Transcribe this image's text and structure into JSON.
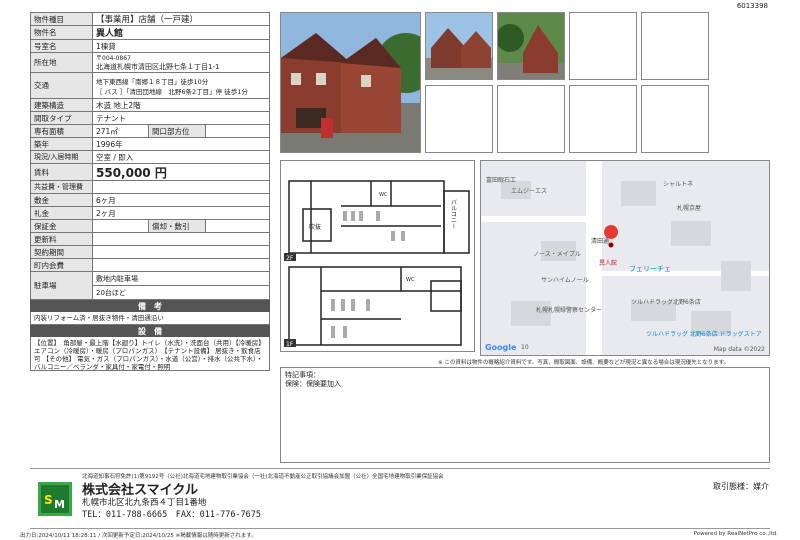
{
  "doc_id": "6013398",
  "table": {
    "rows": [
      {
        "label": "物件種目",
        "value": "【事業用】店舗（一戸建）"
      },
      {
        "label": "物件名",
        "value": "異人館"
      },
      {
        "label": "号室名",
        "value": "1棟貸"
      },
      {
        "label": "所在地",
        "value_line1": "〒004-0867",
        "value_line2": "北海道札幌市清田区北野七条１丁目1-1"
      },
      {
        "label": "交通",
        "value_line1": "地下東西線「南郷１８丁目」徒歩10分",
        "value_line2": "［ バス ］「清田団地線　北野6条2丁目」停 徒歩1分"
      },
      {
        "label": "建築構造",
        "value": "木造 地上2階"
      },
      {
        "label": "間取タイプ",
        "value": "テナント"
      },
      {
        "label": "専有面積",
        "value": "271㎡",
        "sub_label": "間口部方位",
        "sub_value": ""
      },
      {
        "label": "築年",
        "value": "1996年"
      },
      {
        "label": "現況/入居時期",
        "value": "空室 / 即入"
      },
      {
        "label": "賃料",
        "value": "550,000 円"
      },
      {
        "label": "共益費・管理費",
        "value": ""
      },
      {
        "label": "敷金",
        "value": "6ヶ月"
      },
      {
        "label": "礼金",
        "value": "2ヶ月"
      },
      {
        "label": "保証金",
        "value": "",
        "sub_label": "償却・敷引",
        "sub_value": ""
      },
      {
        "label": "更新料",
        "value": ""
      },
      {
        "label": "契約期間",
        "value": ""
      },
      {
        "label": "町内会費",
        "value": ""
      },
      {
        "label": "駐車場",
        "value": "敷地内駐車場",
        "value2": "20台ほど"
      }
    ],
    "remarks_header": "備　考",
    "remarks_text": "内装リフォーム済・居抜き物件・清田通沿い",
    "facilities_header": "設　備",
    "facilities_text": "【位置】　角部屋・最上階【水廻り】トイレ（水洗）・洗面台（共用）【冷暖房】 エアコン（冷暖房）・暖房（プロパンガス）　【テナント設備】 居抜き・飲食店可 【その他】 電気・ガス（プロパンガス）・水道（公営）・排水（公共下水）・バルコニー／ベランダ・家具付・家電付・照明"
  },
  "plan": {
    "balcony_label": "バルコニー",
    "stair_label": "吹抜",
    "floor2": "2F",
    "floor1": "1F",
    "wc": "WC"
  },
  "map": {
    "labels": [
      "富田眼石工",
      "エムジーエス",
      "シャルトネ",
      "札幌京屋",
      "清田通",
      "ノース・メイプル",
      "異人館",
      "フェリーチェ",
      "サンハイムノール",
      "ツルハドラッグ北野6条店",
      "札幌札幌緑警察センター",
      "ツルハドラッグ 北野6条店 ドラッグストア"
    ],
    "google": "Google",
    "num": "10",
    "credit": "Map data ©2022"
  },
  "map_note": "※ この資料は物件の概略紹介資料です。写真、間取図面、設備、概要などが現況と異なる場合は現況優先となります。",
  "notes": {
    "title": "特記事項：",
    "text": "保険：保険要加入"
  },
  "footer": {
    "license": "北海道知事石狩免許(1)第9192号（公社)北海道宅地建物取引業協会（一社)北海道不動産公正取引協議会加盟（公社）全国宅地建物取引業保証協会",
    "company": "株式会社スマイクル",
    "address": "札幌市北区北九条西４丁目1番地",
    "tel": "TEL：011-788-6665　FAX：011-776-7675",
    "deal": "取引態様：媒介",
    "output": "出力日:2024/10/11 18:28:11 / 次回更新予定日:2024/10/25 ※掲載情報は随時更新されます。",
    "powered": "Powered by RealNetPro co.,ltd."
  }
}
